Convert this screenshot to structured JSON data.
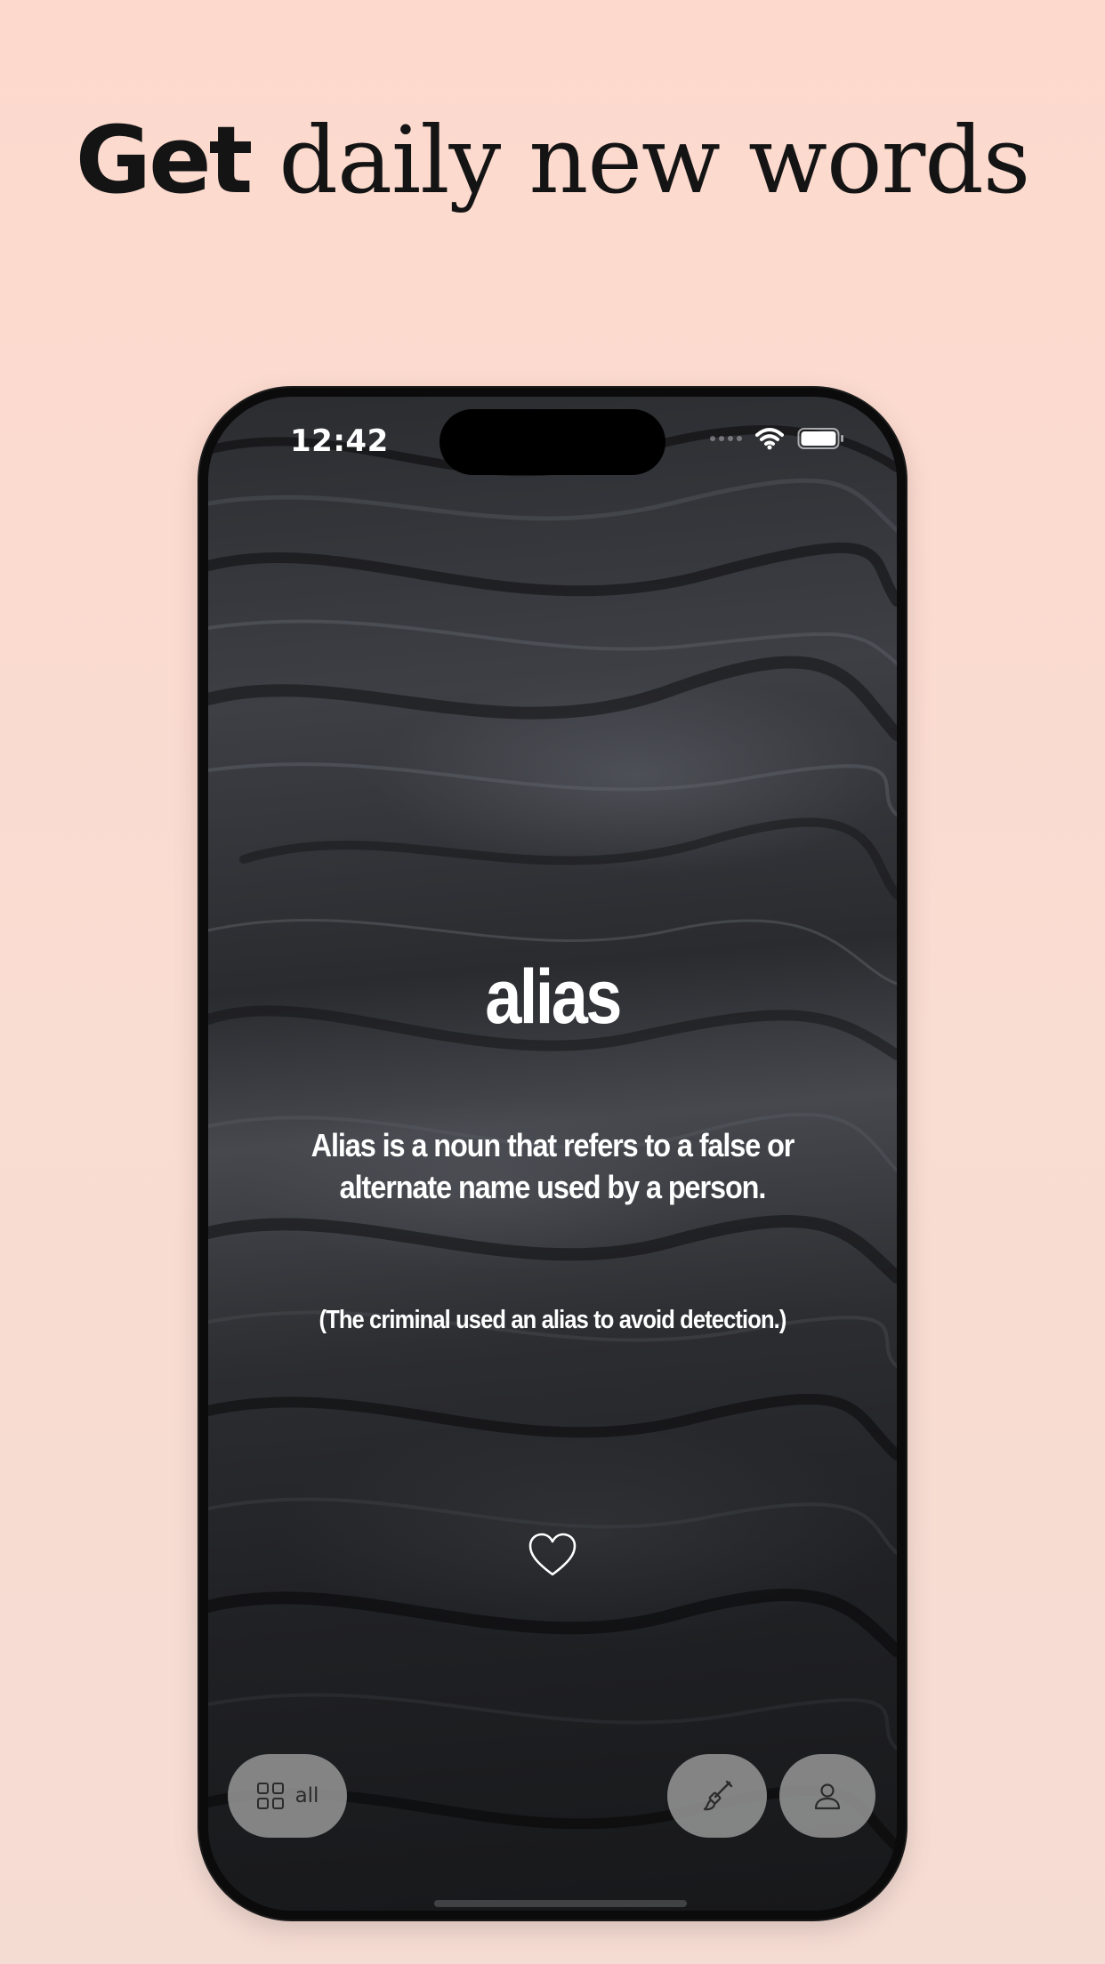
{
  "headline": {
    "bold": "Get",
    "rest": " daily new words"
  },
  "status_bar": {
    "time": "12:42",
    "icons": [
      "signal-dots-icon",
      "wifi-icon",
      "battery-icon"
    ]
  },
  "word_card": {
    "word": "alias",
    "definition": "Alias is a noun that refers to a false or alternate name used by a person.",
    "example": "(The criminal used an alias to avoid detection.)",
    "favorite_icon": "heart-outline-icon"
  },
  "bottom_bar": {
    "category_button": {
      "icon": "grid-icon",
      "label": "all"
    },
    "theme_button": {
      "icon": "paintbrush-icon"
    },
    "profile_button": {
      "icon": "person-icon"
    }
  },
  "colors": {
    "page_background": "#fdd9cd",
    "phone_bezel": "#0b0b0c",
    "text_on_screen": "#ffffff",
    "pill_background": "#969696"
  }
}
